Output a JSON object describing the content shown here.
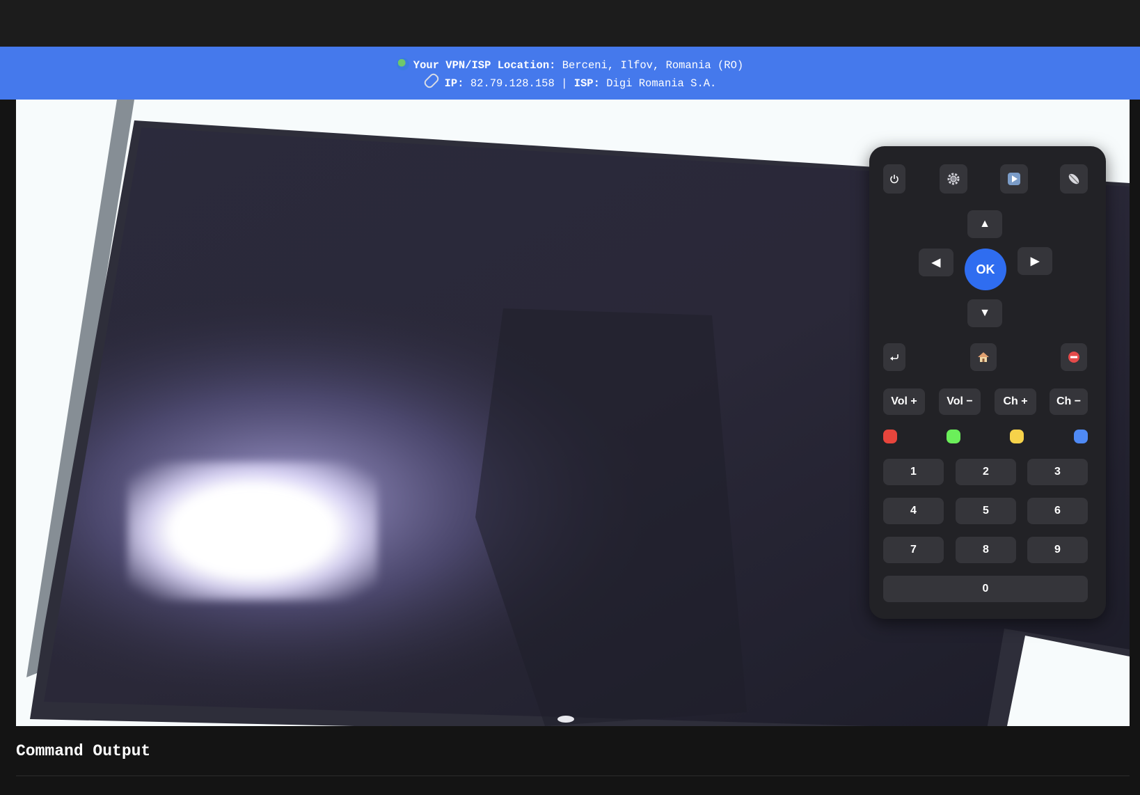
{
  "vpn_banner": {
    "location_label": "Your VPN/ISP Location:",
    "location_value": "Berceni, Ilfov, Romania (RO)",
    "ip_label": "IP:",
    "ip_value": "82.79.128.158",
    "separator": "|",
    "isp_label": "ISP:",
    "isp_value": "Digi Romania S.A.",
    "icons": [
      "globe-icon",
      "link-icon"
    ]
  },
  "remote": {
    "top_icons": [
      "power-icon",
      "settings-icon",
      "play-icon",
      "satellite-icon"
    ],
    "dpad": {
      "up": "▲",
      "down": "▼",
      "left": "◀",
      "right": "▶",
      "ok": "OK"
    },
    "nav_icons": [
      "back-icon",
      "home-icon",
      "stop-icon"
    ],
    "vol_up": "Vol +",
    "vol_down": "Vol −",
    "ch_up": "Ch +",
    "ch_down": "Ch −",
    "color_keys": [
      {
        "name": "red",
        "color": "#e8453c"
      },
      {
        "name": "green",
        "color": "#6bef5a"
      },
      {
        "name": "yellow",
        "color": "#f6d24a"
      },
      {
        "name": "blue",
        "color": "#4f8af5"
      }
    ],
    "digits": [
      "1",
      "2",
      "3",
      "4",
      "5",
      "6",
      "7",
      "8",
      "9",
      "0"
    ]
  },
  "command_output": {
    "title": "Command Output"
  },
  "colors": {
    "banner": "#4579ec",
    "ok_button": "#2f6df0",
    "remote_bg": "#222226",
    "page_bg": "#141414"
  }
}
